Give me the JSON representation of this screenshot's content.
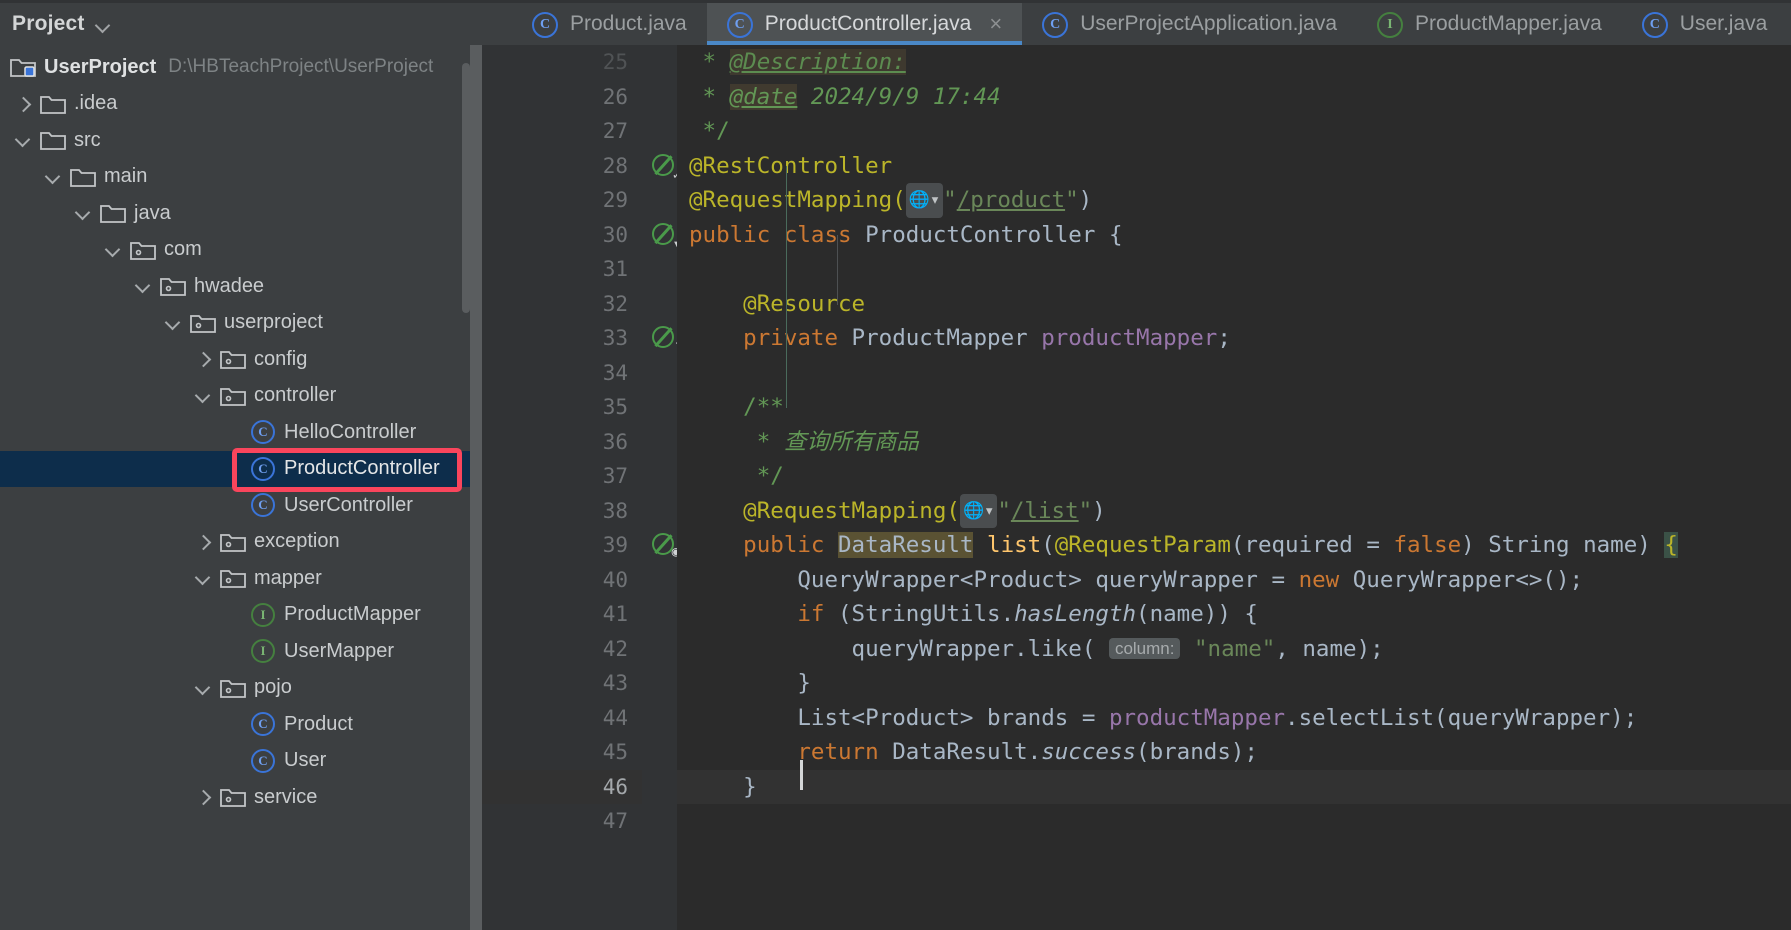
{
  "sidebar": {
    "panel_title": "Project",
    "chevron_icon": "chevron-down-icon",
    "project": {
      "name": "UserProject",
      "path": "D:\\HBTeachProject\\UserProject"
    },
    "items": [
      {
        "label": ".idea",
        "indent": 0,
        "kind": "folder",
        "state": "collapsed"
      },
      {
        "label": "src",
        "indent": 0,
        "kind": "folder",
        "state": "expanded"
      },
      {
        "label": "main",
        "indent": 1,
        "kind": "folder",
        "state": "expanded"
      },
      {
        "label": "java",
        "indent": 2,
        "kind": "folder",
        "state": "expanded"
      },
      {
        "label": "com",
        "indent": 3,
        "kind": "package",
        "state": "expanded"
      },
      {
        "label": "hwadee",
        "indent": 4,
        "kind": "package",
        "state": "expanded"
      },
      {
        "label": "userproject",
        "indent": 5,
        "kind": "package",
        "state": "expanded"
      },
      {
        "label": "config",
        "indent": 6,
        "kind": "package",
        "state": "collapsed"
      },
      {
        "label": "controller",
        "indent": 6,
        "kind": "package",
        "state": "expanded"
      },
      {
        "label": "HelloController",
        "indent": 7,
        "kind": "class",
        "state": "leaf"
      },
      {
        "label": "ProductController",
        "indent": 7,
        "kind": "class",
        "state": "leaf",
        "selected": true,
        "annotated": true
      },
      {
        "label": "UserController",
        "indent": 7,
        "kind": "class",
        "state": "leaf"
      },
      {
        "label": "exception",
        "indent": 6,
        "kind": "package",
        "state": "collapsed"
      },
      {
        "label": "mapper",
        "indent": 6,
        "kind": "package",
        "state": "expanded"
      },
      {
        "label": "ProductMapper",
        "indent": 7,
        "kind": "interface",
        "state": "leaf"
      },
      {
        "label": "UserMapper",
        "indent": 7,
        "kind": "interface",
        "state": "leaf"
      },
      {
        "label": "pojo",
        "indent": 6,
        "kind": "package",
        "state": "expanded"
      },
      {
        "label": "Product",
        "indent": 7,
        "kind": "class",
        "state": "leaf"
      },
      {
        "label": "User",
        "indent": 7,
        "kind": "class",
        "state": "leaf"
      },
      {
        "label": "service",
        "indent": 6,
        "kind": "package",
        "state": "collapsed"
      }
    ]
  },
  "tabs": [
    {
      "label": "Product.java",
      "icon": "class-icon",
      "active": false,
      "closable": false
    },
    {
      "label": "ProductController.java",
      "icon": "class-icon",
      "active": true,
      "closable": true,
      "close_label": "×"
    },
    {
      "label": "UserProjectApplication.java",
      "icon": "class-run-icon",
      "active": false,
      "closable": false
    },
    {
      "label": "ProductMapper.java",
      "icon": "interface-icon",
      "active": false,
      "closable": false
    },
    {
      "label": "User.java",
      "icon": "class-icon",
      "active": false,
      "closable": false
    }
  ],
  "editor": {
    "file": "ProductController.java",
    "first_visible_line": 25,
    "caret_line": 46,
    "lines": [
      {
        "n": "25",
        "partial": true
      },
      {
        "n": "26"
      },
      {
        "n": "27"
      },
      {
        "n": "28",
        "gutter": "run-method-icon"
      },
      {
        "n": "29"
      },
      {
        "n": "30",
        "gutter": "run-class-icon"
      },
      {
        "n": "31"
      },
      {
        "n": "32"
      },
      {
        "n": "33",
        "gutter": "navigate-icon"
      },
      {
        "n": "34"
      },
      {
        "n": "35"
      },
      {
        "n": "36"
      },
      {
        "n": "37"
      },
      {
        "n": "38"
      },
      {
        "n": "39",
        "gutter": "web-mapping-icon"
      },
      {
        "n": "40"
      },
      {
        "n": "41"
      },
      {
        "n": "42"
      },
      {
        "n": "43"
      },
      {
        "n": "44"
      },
      {
        "n": "45"
      },
      {
        "n": "46",
        "current": true
      },
      {
        "n": "47"
      }
    ],
    "code": {
      "l25_tail": "@Description:",
      "l26_star": " * ",
      "l26_tag": "@date",
      "l26_val": " 2024/9/9 17:44",
      "l27": " */",
      "l28": "@RestController",
      "l29_a": "@RequestMapping(",
      "l29_str": "\"/product\"",
      "l29_b": ")",
      "l30_kw": "public class",
      "l30_name": " ProductController ",
      "l30_brace": "{",
      "l32": "    @Resource",
      "l33_kw": "    private",
      "l33_typ": " ProductMapper ",
      "l33_fld": "productMapper",
      "l33_semi": ";",
      "l35": "    /**",
      "l36": "     * 查询所有商品",
      "l37": "     */",
      "l38_a": "    @RequestMapping(",
      "l38_str": "\"/list\"",
      "l38_b": ")",
      "l39_kw": "    public ",
      "l39_type": "DataResult",
      "l39_mth": " list",
      "l39_p1": "(",
      "l39_ann": "@RequestParam",
      "l39_p2": "(required = ",
      "l39_false": "false",
      "l39_p3": ") String name) ",
      "l39_brace": "{",
      "l40": "        QueryWrapper<Product> queryWrapper = ",
      "l40_kw": "new",
      "l40_b": " QueryWrapper<>();",
      "l41_kw": "        if",
      "l41_a": " (StringUtils.",
      "l41_m": "hasLength",
      "l41_b": "(name)) {",
      "l42_a": "            queryWrapper.like( ",
      "l42_hint": "column:",
      "l42_str": " \"name\"",
      "l42_b": ", name);",
      "l43": "        }",
      "l44_a": "        List<Product> brands = ",
      "l44_f": "productMapper",
      "l44_b": ".selectList(queryWrapper);",
      "l45_kw": "        return",
      "l45_a": " DataResult.",
      "l45_m": "success",
      "l45_b": "(brands);",
      "l46": "    }"
    },
    "hint_labels": {
      "column": "column:"
    },
    "globe_icon": "web-url-icon"
  },
  "colors": {
    "accent_tab_underline": "#4a88c7",
    "selection": "#0d2d4b",
    "annotation_box": "#f9455c",
    "editor_bg": "#2b2b2b",
    "panel_bg": "#3c3f41",
    "gutter_bg": "#313335",
    "keyword": "#cc7832",
    "annotation": "#bbb529",
    "string": "#6a8759",
    "comment": "#629755",
    "field": "#9876aa",
    "method": "#ffc66d",
    "text": "#a9b7c6"
  }
}
